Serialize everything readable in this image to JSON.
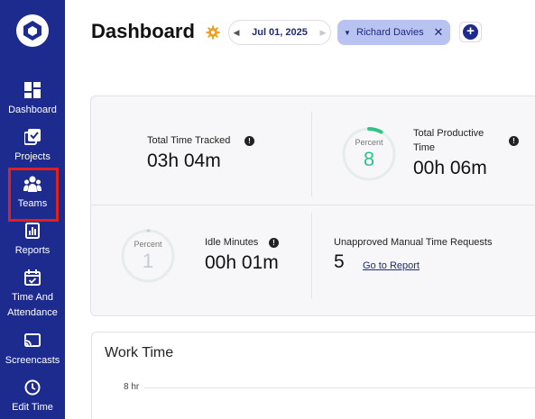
{
  "sidebar": {
    "items": [
      {
        "label": "Dashboard",
        "icon": "dashboard-grid-icon"
      },
      {
        "label": "Projects",
        "icon": "projects-checkbox-icon"
      },
      {
        "label": "Teams",
        "icon": "teams-people-icon"
      },
      {
        "label": "Reports",
        "icon": "reports-chart-icon"
      },
      {
        "label": "Time And Attendance",
        "icon": "calendar-check-icon"
      },
      {
        "label": "Screencasts",
        "icon": "cast-icon"
      },
      {
        "label": "Edit Time",
        "icon": "clock-icon"
      }
    ],
    "highlighted_item": "Teams"
  },
  "header": {
    "title": "Dashboard",
    "date": "Jul 01, 2025",
    "user_filter": "Richard Davies"
  },
  "stats": {
    "total_time_tracked": {
      "label": "Total Time Tracked",
      "value": "03h 04m"
    },
    "total_productive_time": {
      "label_line1": "Total Productive",
      "label_line2": "Time",
      "value": "00h 06m",
      "ring_label": "Percent",
      "percent": "8"
    },
    "idle_minutes": {
      "label": "Idle Minutes",
      "value": "00h 01m",
      "ring_label": "Percent",
      "percent": "1"
    },
    "unapproved_requests": {
      "label": "Unapproved Manual Time Requests",
      "value": "5",
      "link": "Go to Report"
    }
  },
  "work_time": {
    "title": "Work Time",
    "y_tick": "8 hr"
  },
  "colors": {
    "sidebar": "#1d2b8f",
    "accent_green": "#2fc486",
    "gear_orange": "#f0a020",
    "highlight_red": "#e0201f"
  }
}
